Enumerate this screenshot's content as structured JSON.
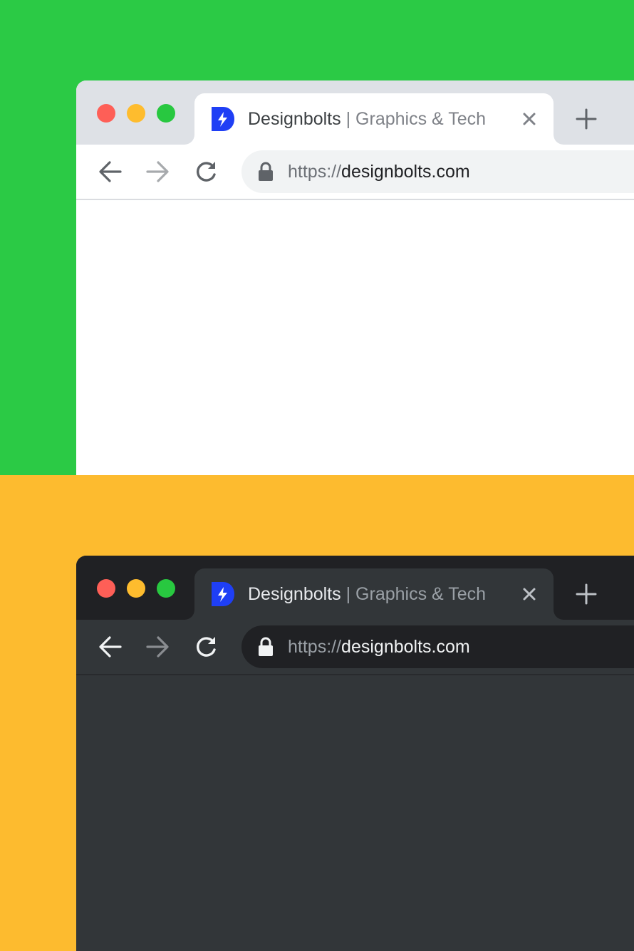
{
  "colors": {
    "top_background": "#2bca45",
    "bottom_background": "#fdbb2f",
    "traffic_close": "#fe5f57",
    "traffic_minimize": "#febc2e",
    "traffic_maximize": "#28c840",
    "favicon": "#1f3ff5"
  },
  "light_window": {
    "theme": "light",
    "tab": {
      "favicon_icon": "designbolts-bolt-icon",
      "title": "Designbolts",
      "separator": "|",
      "subtitle": "Graphics & Tech",
      "close_icon": "close-icon"
    },
    "new_tab_icon": "plus-icon",
    "toolbar": {
      "back_icon": "arrow-left-icon",
      "forward_icon": "arrow-right-icon",
      "reload_icon": "reload-icon"
    },
    "address_bar": {
      "lock_icon": "lock-icon",
      "scheme": "https://",
      "host": "designbolts.com"
    }
  },
  "dark_window": {
    "theme": "dark",
    "tab": {
      "favicon_icon": "designbolts-bolt-icon",
      "title": "Designbolts",
      "separator": "|",
      "subtitle": "Graphics & Tech",
      "close_icon": "close-icon"
    },
    "new_tab_icon": "plus-icon",
    "toolbar": {
      "back_icon": "arrow-left-icon",
      "forward_icon": "arrow-right-icon",
      "reload_icon": "reload-icon"
    },
    "address_bar": {
      "lock_icon": "lock-icon",
      "scheme": "https://",
      "host": "designbolts.com"
    }
  }
}
